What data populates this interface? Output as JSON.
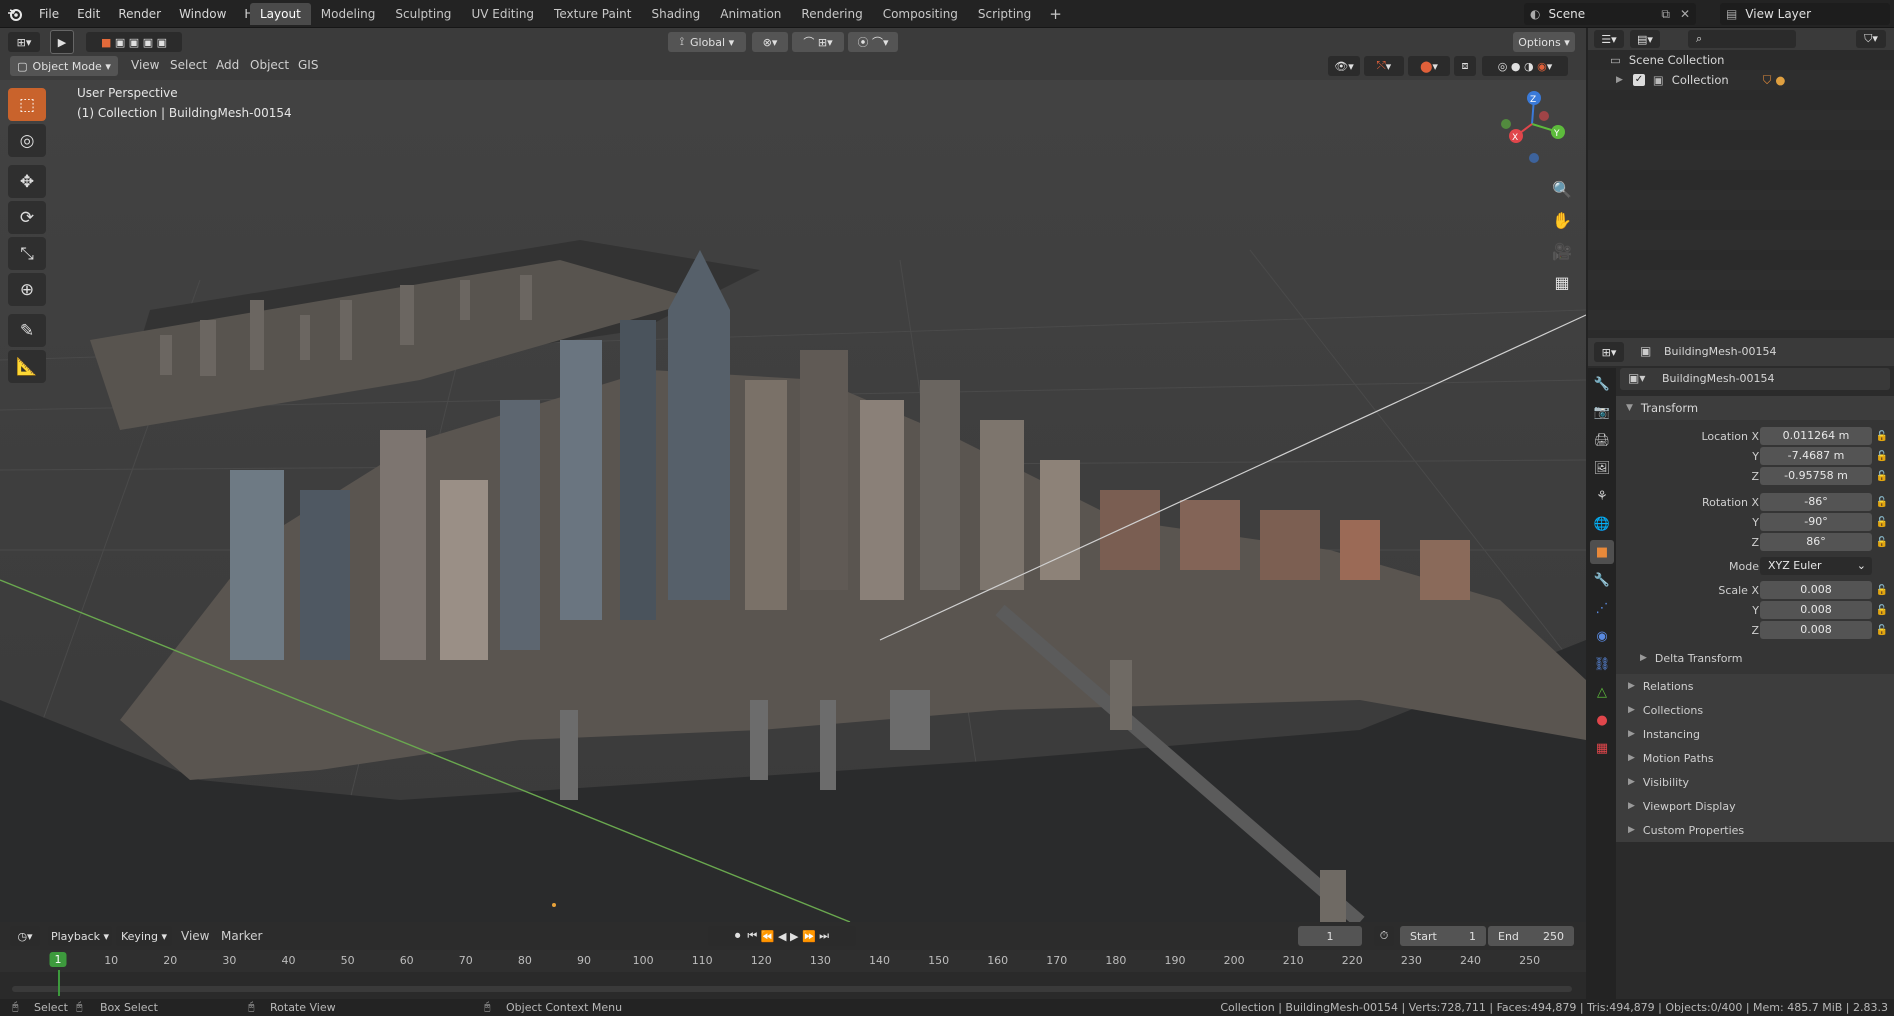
{
  "topbar": {
    "menus": [
      "File",
      "Edit",
      "Render",
      "Window",
      "Help"
    ],
    "workspace_tabs": [
      "Layout",
      "Modeling",
      "Sculpting",
      "UV Editing",
      "Texture Paint",
      "Shading",
      "Animation",
      "Rendering",
      "Compositing",
      "Scripting"
    ],
    "active_tab": "Layout",
    "add_tab": "+",
    "scene_name": "Scene",
    "view_layer": "View Layer"
  },
  "viewport_header": {
    "mode": "Object Mode",
    "menus": [
      "View",
      "Select",
      "Add",
      "Object",
      "GIS"
    ],
    "orientation": "Global",
    "options_label": "Options"
  },
  "viewport": {
    "perspective_label": "User Perspective",
    "object_label": "(1) Collection | BuildingMesh-00154",
    "gizmo_axes": {
      "x": "X",
      "y": "Y",
      "z": "Z"
    }
  },
  "timeline": {
    "menus": [
      "Playback",
      "Keying",
      "View",
      "Marker"
    ],
    "current_frame": "1",
    "start_label": "Start",
    "start": "1",
    "end_label": "End",
    "end": "250",
    "ruler": [
      "1",
      "10",
      "20",
      "30",
      "40",
      "50",
      "60",
      "70",
      "80",
      "90",
      "100",
      "110",
      "120",
      "130",
      "140",
      "150",
      "160",
      "170",
      "180",
      "190",
      "200",
      "210",
      "220",
      "230",
      "240",
      "250"
    ]
  },
  "statusbar": {
    "select": "Select",
    "box_select": "Box Select",
    "rotate_view": "Rotate View",
    "context_menu": "Object Context Menu",
    "stats": "Collection | BuildingMesh-00154 | Verts:728,711 | Faces:494,879 | Tris:494,879 | Objects:0/400 | Mem: 485.7 MiB | 2.83.3"
  },
  "outliner": {
    "scene_collection": "Scene Collection",
    "collection": "Collection"
  },
  "properties": {
    "object_name_header": "BuildingMesh-00154",
    "object_name_field": "BuildingMesh-00154",
    "transform_title": "Transform",
    "location": {
      "label_x": "Location X",
      "label_y": "Y",
      "label_z": "Z",
      "x": "0.011264 m",
      "y": "-7.4687 m",
      "z": "-0.95758 m"
    },
    "rotation": {
      "label_x": "Rotation X",
      "label_y": "Y",
      "label_z": "Z",
      "x": "-86°",
      "y": "-90°",
      "z": "86°"
    },
    "mode_label": "Mode",
    "mode_value": "XYZ Euler",
    "scale": {
      "label_x": "Scale X",
      "label_y": "Y",
      "label_z": "Z",
      "x": "0.008",
      "y": "0.008",
      "z": "0.008"
    },
    "delta_transform": "Delta Transform",
    "sections": [
      "Relations",
      "Collections",
      "Instancing",
      "Motion Paths",
      "Visibility",
      "Viewport Display",
      "Custom Properties"
    ]
  },
  "colors": {
    "accent": "#c9632c",
    "frame_green": "#3d9a3d",
    "axis_x": "#e0464b",
    "axis_y": "#5dbb3c",
    "axis_z": "#3a7ad9"
  }
}
